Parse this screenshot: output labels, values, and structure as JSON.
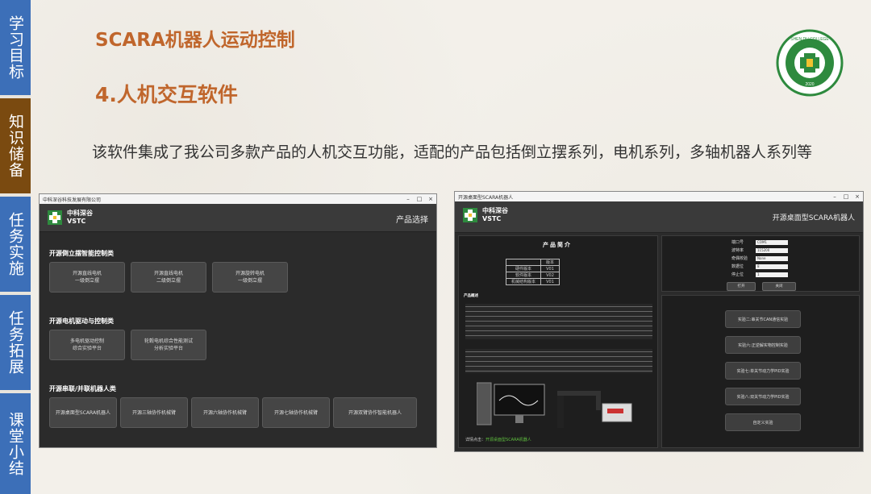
{
  "nav": {
    "items": [
      {
        "label": "学习目标"
      },
      {
        "label": "知识储备"
      },
      {
        "label": "任务实施"
      },
      {
        "label": "任务拓展"
      },
      {
        "label": "课堂小结"
      }
    ]
  },
  "slide": {
    "title": "SCARA机器人运动控制",
    "subtitle": "4.人机交互软件",
    "description": "该软件集成了我公司多款产品的人机交互功能，适配的产品包括倒立摆系列，电机系列，多轴机器人系列等"
  },
  "logo": {
    "text_top": "SHEN DU COLLEGE",
    "text_bottom": "深度学院",
    "year": "2020"
  },
  "left_window": {
    "titlebar": "中科深谷科技发展有限公司",
    "brand_cn": "中科深谷",
    "brand_en": "VSTC",
    "header_right": "产品选择",
    "sections": [
      {
        "title": "开源倒立摆智能控制类",
        "buttons": [
          "开源直线电机\n一级倒立摆",
          "开源直线电机\n二级倒立摆",
          "开源旋转电机\n一级倒立摆"
        ]
      },
      {
        "title": "开源电机驱动与控制类",
        "buttons": [
          "多电机驱动控制\n综合实验平台",
          "轮毂电机综合性能测试\n分析实验平台"
        ]
      },
      {
        "title": "开源串联/并联机器人类",
        "buttons": [
          "开源桌面型SCARA机器人",
          "开源三轴协作机械臂",
          "开源六轴协作机械臂",
          "开源七轴协作机械臂",
          "开源双臂协作智能机器人"
        ]
      }
    ]
  },
  "right_window": {
    "titlebar": "开源桌面型SCARA机器人",
    "brand_cn": "中科深谷",
    "brand_en": "VSTC",
    "header_right": "开源桌面型SCARA机器人",
    "intro_title": "产品简介",
    "version_table": [
      [
        "",
        "版本"
      ],
      [
        "硬件版本",
        "V01"
      ],
      [
        "软件版本",
        "V02"
      ],
      [
        "机械结构版本",
        "V01"
      ]
    ],
    "overview_label": "产品概述",
    "settings": [
      {
        "key": "端口号",
        "value": "COM1"
      },
      {
        "key": "波特率",
        "value": "115200"
      },
      {
        "key": "奇偶校验",
        "value": "None"
      },
      {
        "key": "数据位",
        "value": "8"
      },
      {
        "key": "停止位",
        "value": "1"
      }
    ],
    "open_label": "打开",
    "close_label": "关闭",
    "experiments": [
      "实验二:串关节CAN通信实验",
      "实验六:正逆解实物控制实验",
      "实验七:单关节动力学PID实验",
      "实验八:双关节动力学PID实验",
      "自定义实验"
    ],
    "detail_label": "详情点击：",
    "detail_link": "开源桌面型SCARA机器人"
  }
}
